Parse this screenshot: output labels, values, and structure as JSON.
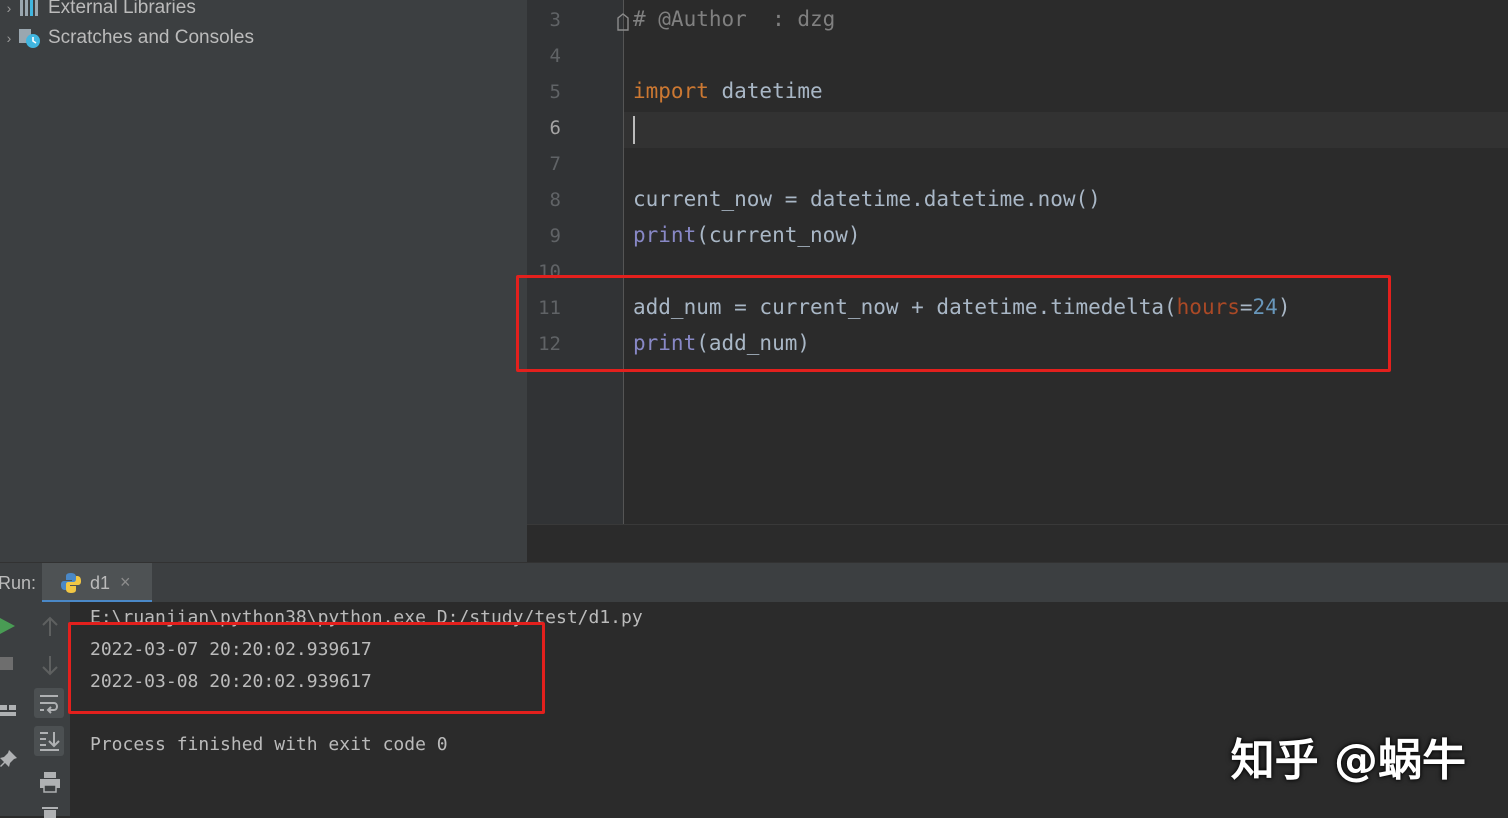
{
  "project_tree": {
    "items": [
      {
        "label": "External Libraries"
      },
      {
        "label": "Scratches and Consoles"
      }
    ]
  },
  "editor": {
    "lines": [
      {
        "number": "3",
        "tokens": [
          {
            "t": "# @Author  : dzg",
            "c": "cm"
          }
        ]
      },
      {
        "number": "4",
        "tokens": []
      },
      {
        "number": "5",
        "tokens": [
          {
            "t": "import",
            "c": "kw"
          },
          {
            "t": " datetime",
            "c": ""
          }
        ]
      },
      {
        "number": "6",
        "tokens": []
      },
      {
        "number": "7",
        "tokens": []
      },
      {
        "number": "8",
        "tokens": [
          {
            "t": "current_now = datetime.datetime.now()",
            "c": ""
          }
        ]
      },
      {
        "number": "9",
        "tokens": [
          {
            "t": "print",
            "c": "bi"
          },
          {
            "t": "(current_now)",
            "c": ""
          }
        ]
      },
      {
        "number": "10",
        "tokens": []
      },
      {
        "number": "11",
        "tokens": [
          {
            "t": "add_num = current_now + datetime.timedelta(",
            "c": ""
          },
          {
            "t": "hours",
            "c": "param"
          },
          {
            "t": "=",
            "c": ""
          },
          {
            "t": "24",
            "c": "num"
          },
          {
            "t": ")",
            "c": ""
          }
        ]
      },
      {
        "number": "12",
        "tokens": [
          {
            "t": "print",
            "c": "bi"
          },
          {
            "t": "(add_num)",
            "c": ""
          }
        ]
      }
    ],
    "current_line": "6"
  },
  "run_panel": {
    "label": "Run:",
    "tab_name": "d1",
    "tab_close": "×",
    "console": {
      "command": "E:\\ruanjian\\python38\\python.exe D:/study/test/d1.py",
      "output_1": "2022-03-07 20:20:02.939617",
      "output_2": "2022-03-08 20:20:02.939617",
      "exit_message": "Process finished with exit code 0"
    }
  },
  "watermark": {
    "text": "知乎 @蜗牛"
  },
  "colors": {
    "highlight_box": "#e3201d",
    "keyword": "#cc7832",
    "builtin": "#8888c6"
  }
}
